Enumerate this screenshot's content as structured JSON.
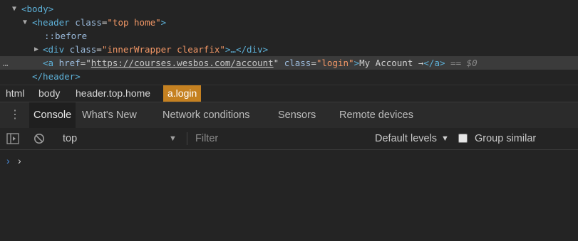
{
  "elements": {
    "line1": {
      "tag": "<body>"
    },
    "line2": {
      "open": "<header",
      "attr": "class",
      "value": "\"top home\"",
      "close": ">"
    },
    "line3": {
      "pseudo": "::before"
    },
    "line4": {
      "open": "<div",
      "attr": "class",
      "value": "\"innerWrapper clearfix\"",
      "close": ">…</div>"
    },
    "line5": {
      "dots": "…",
      "open": "<a",
      "href_attr": "href",
      "href": "https://courses.wesbos.com/account",
      "class_attr": "class",
      "class_value": "\"login\"",
      "gt": ">",
      "text": "My Account →",
      "close": "</a>",
      "eq": "== $0"
    },
    "line6": {
      "tag": "</header>"
    }
  },
  "breadcrumbs": [
    "html",
    "body",
    "header.top.home",
    "a.login"
  ],
  "drawer": {
    "menu_icon": "kebab-icon",
    "tabs": [
      "Console",
      "What's New",
      "Network conditions",
      "Sensors",
      "Remote devices"
    ]
  },
  "toolbar": {
    "context": "top",
    "filter_placeholder": "Filter",
    "levels": "Default levels",
    "group_similar": "Group similar"
  },
  "console": {
    "prompt_chevron": "›",
    "input_chevron": "›"
  },
  "colors": {
    "tag": "#5db0d7",
    "value": "#f29766",
    "active_crumb": "#c58121",
    "prompt": "#4a90e2"
  }
}
